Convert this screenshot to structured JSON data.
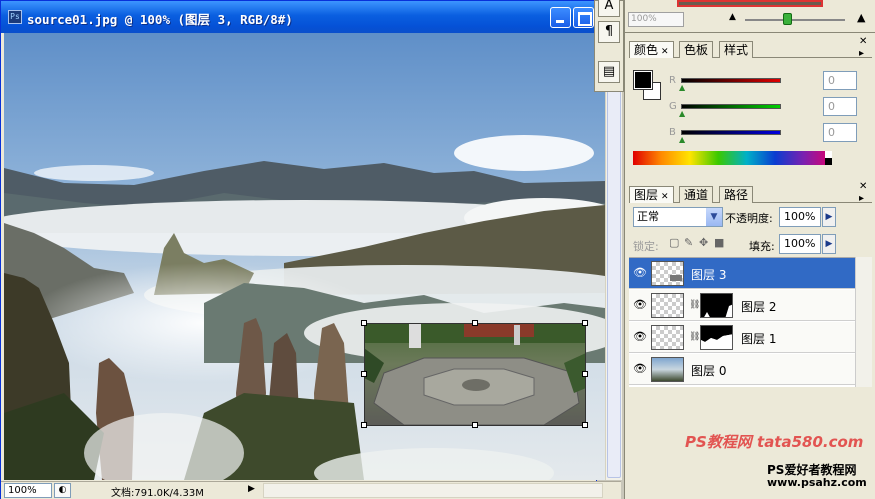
{
  "window": {
    "title": "source01.jpg @ 100% (图层 3, RGB/8#)",
    "icon_text": "Ps"
  },
  "statusbar": {
    "zoom": "100%",
    "doc_info": "文档:791.0K/4.33M"
  },
  "navigator": {
    "zoom": "100%"
  },
  "tools": {
    "text_glyph": "A",
    "para_glyph": "¶",
    "panel_glyph": "▤"
  },
  "color_panel": {
    "tabs": [
      "颜色",
      "色板",
      "样式"
    ],
    "channels": [
      {
        "label": "R",
        "value": "0",
        "color": "#cc0000"
      },
      {
        "label": "G",
        "value": "0",
        "color": "#00aa00"
      },
      {
        "label": "B",
        "value": "0",
        "color": "#0000cc"
      }
    ],
    "foreground": "#000000",
    "background": "#ffffff"
  },
  "layers_panel": {
    "tabs": [
      "图层",
      "通道",
      "路径"
    ],
    "blend_mode": "正常",
    "opacity_label": "不透明度:",
    "opacity": "100%",
    "lock_label": "锁定:",
    "fill_label": "填充:",
    "fill": "100%",
    "layers": [
      {
        "name": "图层 3",
        "selected": true
      },
      {
        "name": "图层 2",
        "selected": false
      },
      {
        "name": "图层 1",
        "selected": false
      },
      {
        "name": "图层 0",
        "selected": false
      }
    ]
  },
  "watermark": {
    "line1": "PS教程网 tata580.com",
    "line2": "PS爱好者教程网",
    "line3": "www.psahz.com"
  }
}
